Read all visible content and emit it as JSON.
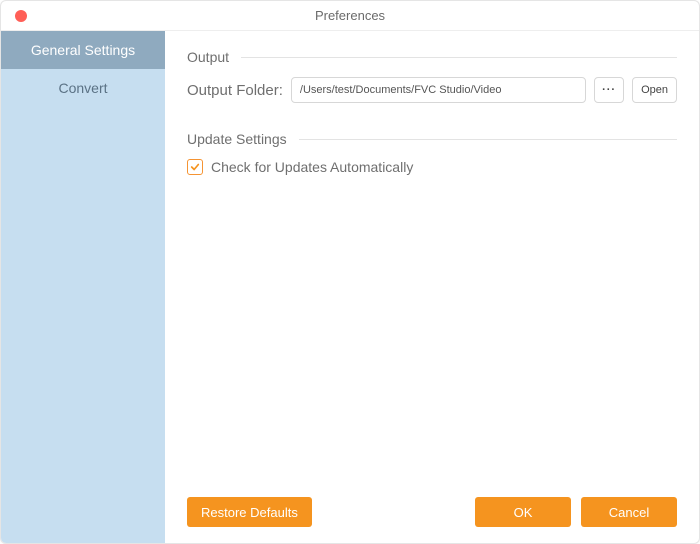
{
  "window": {
    "title": "Preferences"
  },
  "sidebar": {
    "items": [
      {
        "label": "General Settings",
        "active": true
      },
      {
        "label": "Convert",
        "active": false
      }
    ]
  },
  "sections": {
    "output": {
      "title": "Output",
      "folder_label": "Output Folder:",
      "folder_path": "/Users/test/Documents/FVC Studio/Video",
      "browse_label": "···",
      "open_label": "Open"
    },
    "update": {
      "title": "Update Settings",
      "check_label": "Check for Updates Automatically",
      "checked": true
    }
  },
  "footer": {
    "restore_label": "Restore Defaults",
    "ok_label": "OK",
    "cancel_label": "Cancel"
  },
  "colors": {
    "accent": "#f5941f",
    "sidebar_bg": "#c6def0",
    "sidebar_active": "#8faabf"
  }
}
